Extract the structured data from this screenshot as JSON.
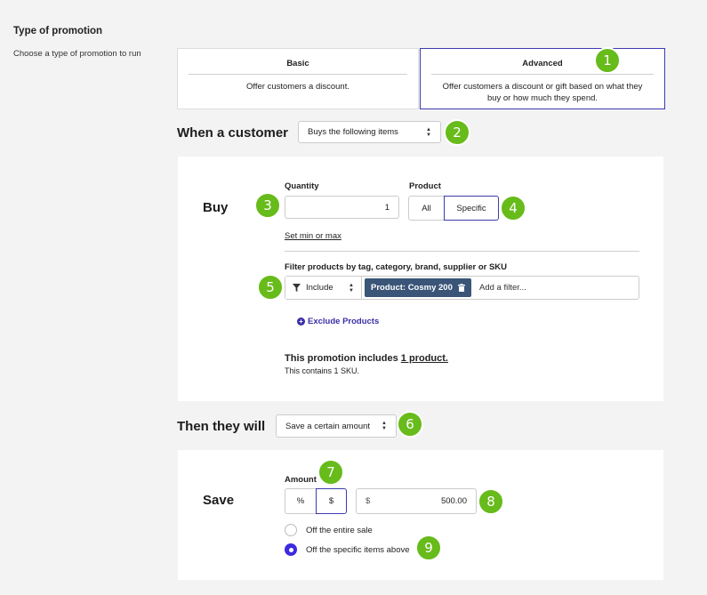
{
  "type_section": {
    "title": "Type of promotion",
    "subtitle": "Choose a type of promotion to run",
    "options": [
      {
        "title": "Basic",
        "description": "Offer customers a discount."
      },
      {
        "title": "Advanced",
        "description": "Offer customers a discount or gift based on what they buy or how much they spend."
      }
    ],
    "selected": "Advanced"
  },
  "when": {
    "heading": "When a customer",
    "select_value": "Buys the following items"
  },
  "buy": {
    "heading": "Buy",
    "quantity_label": "Quantity",
    "quantity_value": "1",
    "product_label": "Product",
    "product_options": [
      "All",
      "Specific"
    ],
    "product_selected": "Specific",
    "set_min_max": "Set min or max",
    "filter_label": "Filter products by tag, category, brand, supplier or SKU",
    "filter_mode": "Include",
    "filter_chip": "Product: Cosmy 200",
    "filter_placeholder": "Add a filter...",
    "exclude_link": "Exclude Products",
    "summary_prefix": "This promotion includes",
    "summary_link": "1 product.",
    "summary_sub": "This contains 1 SKU."
  },
  "then": {
    "heading": "Then they will",
    "select_value": "Save a certain amount"
  },
  "save": {
    "heading": "Save",
    "amount_label": "Amount",
    "unit_options": [
      "%",
      "$"
    ],
    "unit_selected": "$",
    "currency_prefix": "$",
    "amount_value": "500.00",
    "radio_options": [
      "Off the entire sale",
      "Off the specific items above"
    ],
    "radio_selected": "Off the specific items above"
  },
  "callouts": [
    "1",
    "2",
    "3",
    "4",
    "5",
    "6",
    "7",
    "8",
    "9"
  ],
  "colors": {
    "callout_green": "#67bb1a",
    "accent_blue": "#3b3bb0",
    "chip_bg": "#3a5578",
    "radio_on": "#3d2be0",
    "link": "#3a2fa8"
  }
}
